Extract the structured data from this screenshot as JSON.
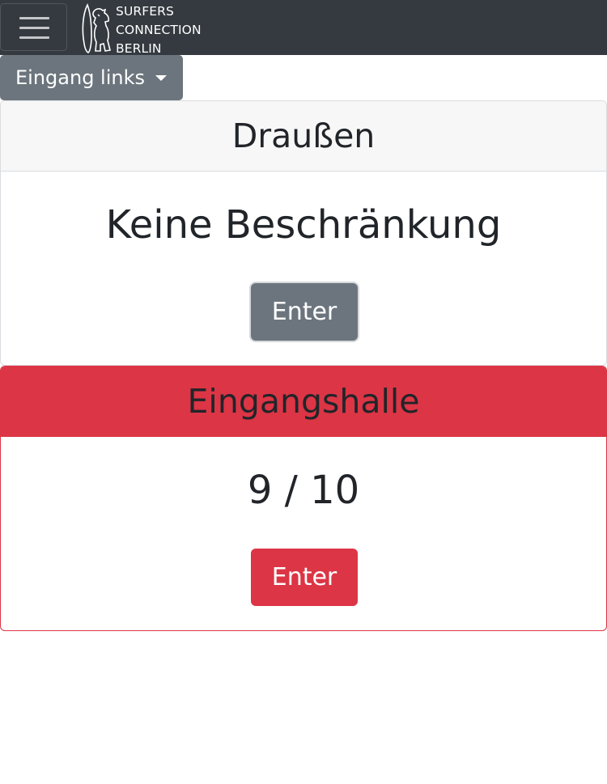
{
  "navbar": {
    "toggler_icon": "hamburger-icon",
    "logo": {
      "line1": "SURFERS",
      "line2": "CONNECTION",
      "line3": "BERLIN",
      "icon": "bear-surfboard-logo"
    }
  },
  "dropdown": {
    "label": "Eingang links",
    "icon": "caret-down-icon"
  },
  "areas": [
    {
      "title": "Draußen",
      "value": "Keine Beschränkung",
      "button": "Enter",
      "color": "#6c757d"
    },
    {
      "title": "Eingangshalle",
      "value": "9 / 10",
      "button": "Enter",
      "color": "#dc3545"
    }
  ],
  "colors": {
    "navbar": "#343a40",
    "secondary": "#6c757d",
    "danger": "#dc3545"
  }
}
